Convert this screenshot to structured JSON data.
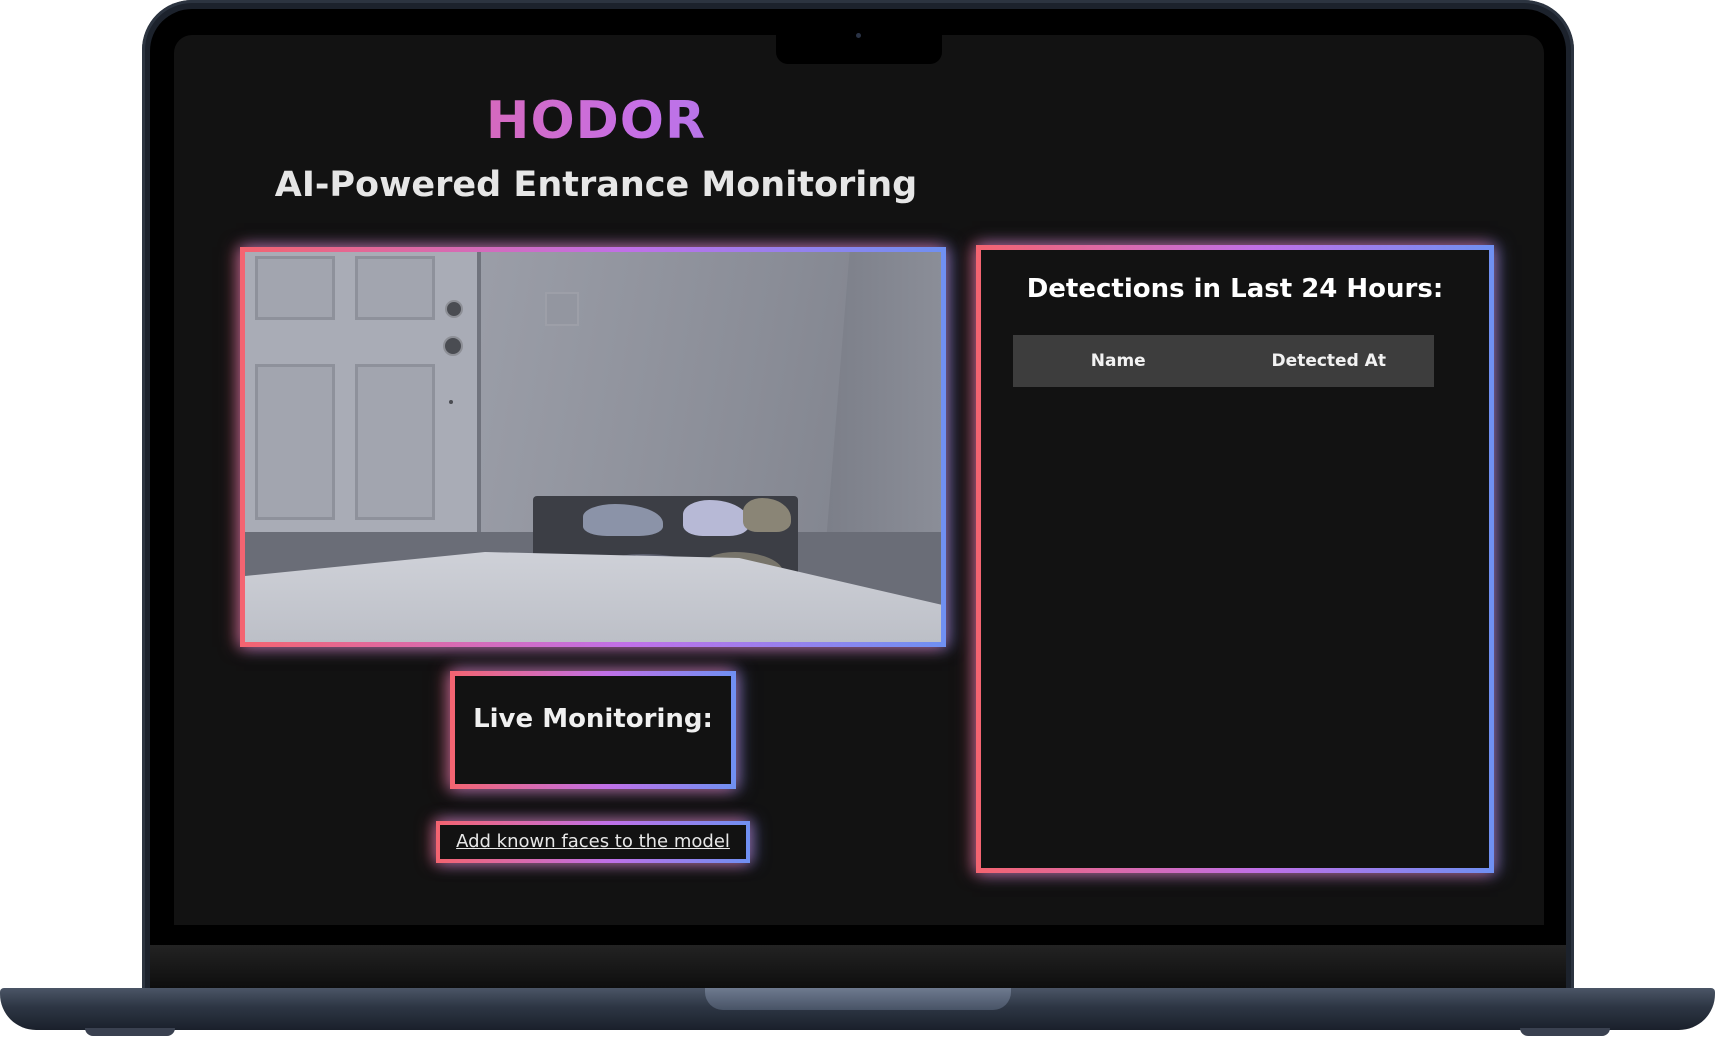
{
  "app": {
    "title": "HODOR",
    "subtitle": "AI-Powered Entrance Monitoring"
  },
  "camera": {
    "feed_alt": "Live camera feed of entrance with door and shoe rack"
  },
  "live_monitoring": {
    "label": "Live Monitoring:"
  },
  "link": {
    "add_faces_label": "Add known faces to the model"
  },
  "detections": {
    "heading": "Detections in Last 24 Hours:",
    "columns": [
      "Name",
      "Detected At"
    ],
    "rows": []
  },
  "colors": {
    "background": "#121212",
    "gradient_start": "#f46470",
    "gradient_mid": "#c070e8",
    "gradient_end": "#6f90f2",
    "table_header_bg": "#3d3d3d",
    "text_primary": "#e6e6e6"
  }
}
